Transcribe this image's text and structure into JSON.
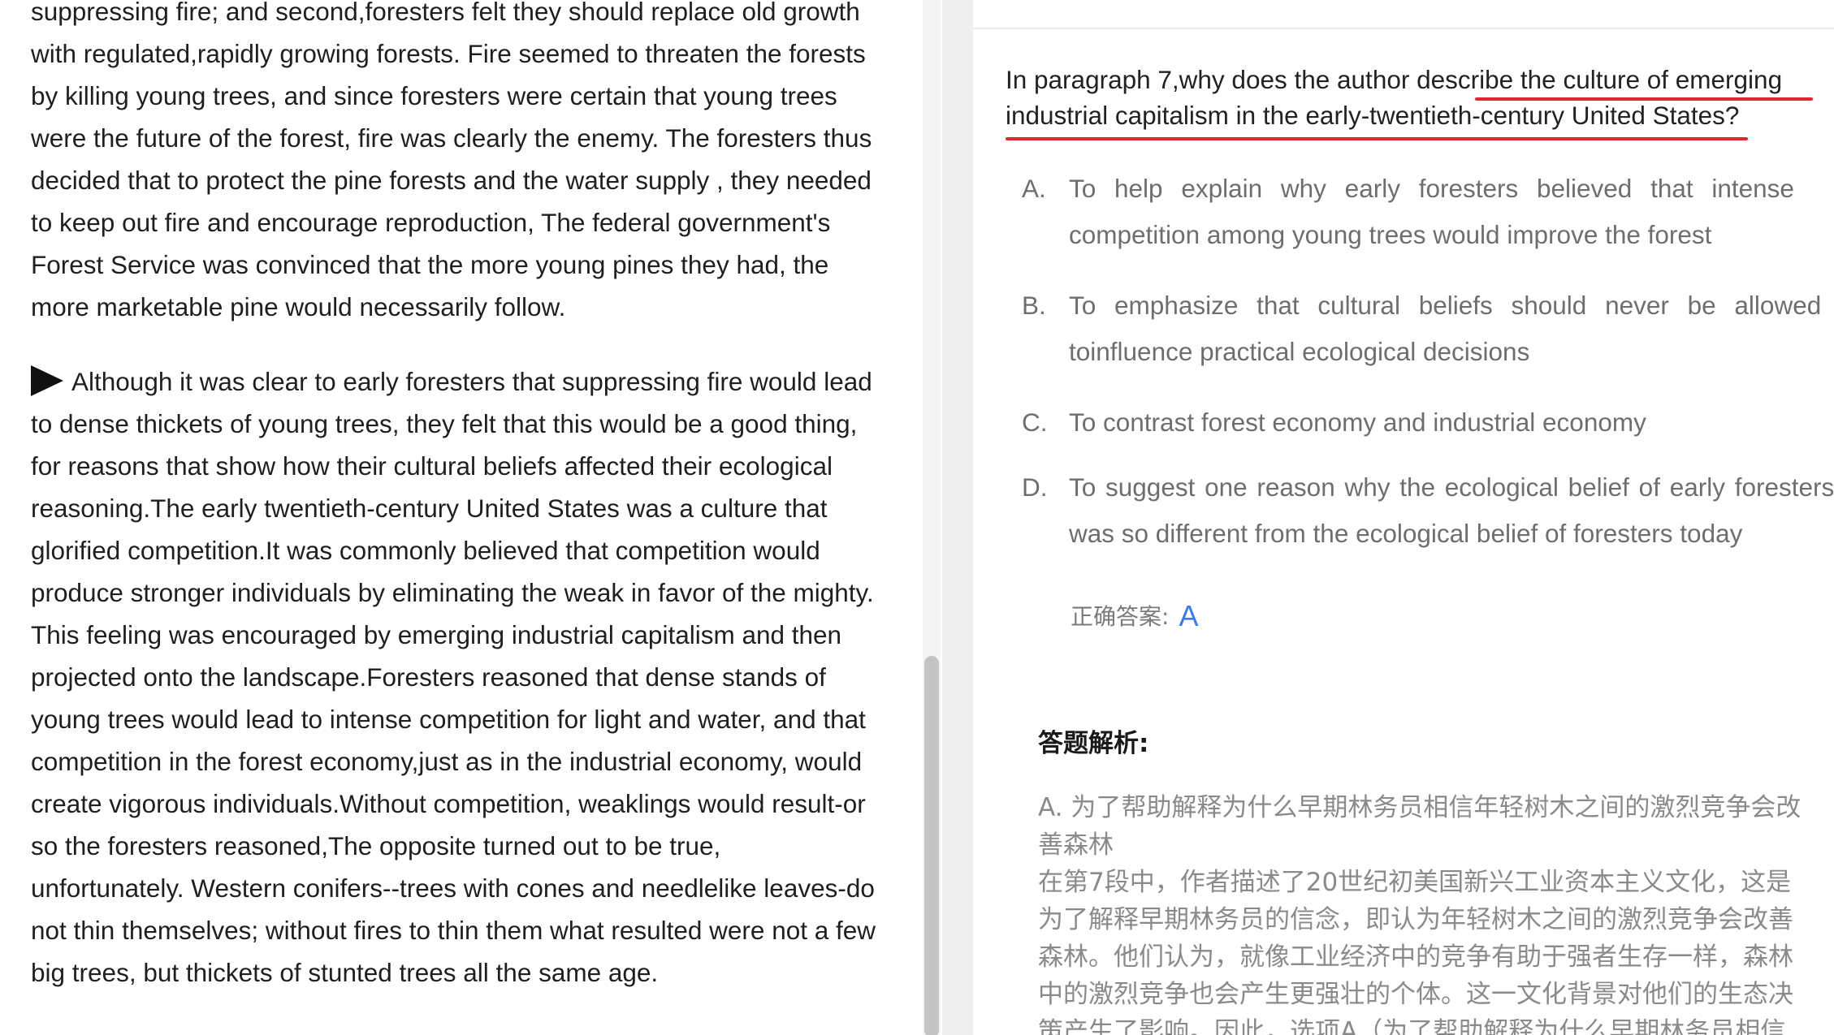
{
  "passage": {
    "paragraph_1_lines": [
      "suppressing fire; and second,foresters felt they should replace old growth",
      "with regulated,rapidly growing forests. Fire seemed to threaten the forests",
      "by killing young trees, and since foresters were certain that young trees",
      "were the future of the forest, fire was clearly the enemy. The foresters thus",
      "decided that to protect the pine forests and the water supply , they needed",
      "to keep out fire and encourage reproduction, The federal government's",
      "Forest Service was convinced that the more young pines they had, the",
      "more marketable pine would necessarily follow."
    ],
    "paragraph_2_lines": [
      "Although it was clear to early foresters that suppressing fire would lead",
      "to dense thickets of young trees, they felt that this would be a good thing,",
      "for reasons that show how their cultural beliefs affected their ecological",
      "reasoning.The early twentieth-century United States was a culture that",
      "glorified competition.It was commonly believed that competition would",
      "produce stronger individuals by eliminating the weak in favor of the mighty.",
      "This feeling was encouraged by emerging industrial capitalism and then",
      "projected onto the landscape.Foresters reasoned that dense stands of",
      "young trees would lead to intense competition for light and water, and that",
      "competition in the forest economy,just as in the industrial economy, would",
      "create vigorous individuals.Without competition, weaklings would result-or",
      "so the foresters reasoned,The opposite turned out to be true,",
      "unfortunately. Western conifers--trees with cones and needlelike leaves-do",
      "not thin themselves; without fires to thin them what resulted were not a few",
      "big trees, but thickets of stunted trees all the same age."
    ]
  },
  "question": {
    "lines": [
      "In paragraph 7,why does the author describe the culture of emerging",
      "industrial capitalism in the early-twentieth-century United States?"
    ],
    "options": [
      {
        "letter": "A.",
        "line1": "To help explain why early foresters believed that intense",
        "line2": "competition among young trees would improve the forest"
      },
      {
        "letter": "B.",
        "line1": "To emphasize that cultural beliefs should never be allowed",
        "line2": "toinfluence practical ecological decisions"
      },
      {
        "letter": "C.",
        "line1": "To contrast forest economy and industrial economy",
        "line2": ""
      },
      {
        "letter": "D.",
        "line1": "To suggest one reason why the ecological belief of early foresters",
        "line2": "was so different from the ecological belief of foresters today"
      }
    ],
    "correct_answer_label": "正确答案:",
    "correct_answer_value": "A"
  },
  "analysis": {
    "title": "答题解析:",
    "lines": [
      "A. 为了帮助解释为什么早期林务员相信年轻树木之间的激烈竞争会改",
      "善森林",
      "在第7段中，作者描述了20世纪初美国新兴工业资本主义文化，这是",
      "为了解释早期林务员的信念，即认为年轻树木之间的激烈竞争会改善",
      "森林。他们认为，就像工业经济中的竞争有助于强者生存一样，森林",
      "中的激烈竞争也会产生更强壮的个体。这一文化背景对他们的生态决",
      "策产生了影响。因此，选项A（为了帮助解释为什么早期林务员相信"
    ]
  },
  "colors": {
    "underline": "#e3252d",
    "answer": "#3d7ce8",
    "option_text": "#6e6e6e",
    "analysis_text": "#8a8a8a"
  }
}
